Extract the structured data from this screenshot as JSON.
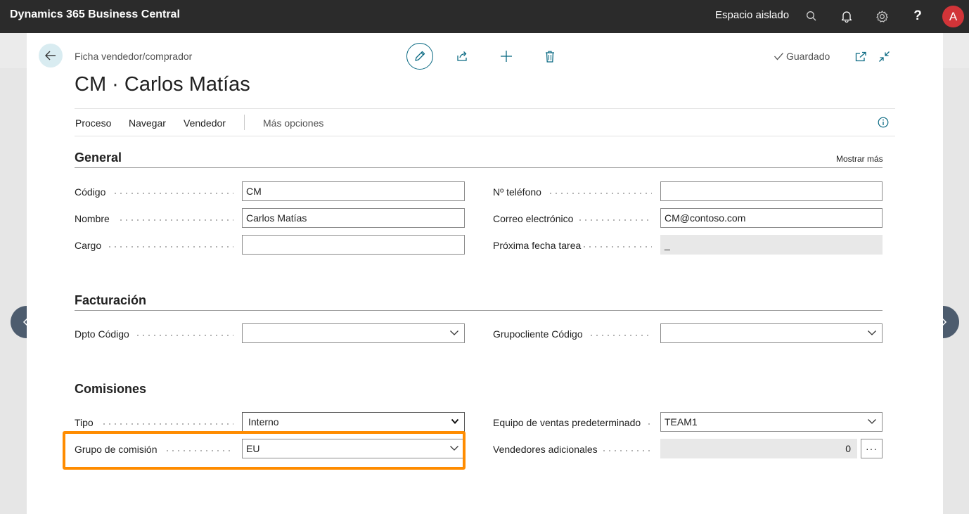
{
  "topbar": {
    "app_title": "Dynamics 365 Business Central",
    "environment": "Espacio aislado",
    "help": "?",
    "avatar_initial": "A",
    "avatar_color": "#d13438"
  },
  "page": {
    "breadcrumb": "Ficha vendedor/comprador",
    "title": "CM · Carlos Matías",
    "saved_status": "Guardado"
  },
  "actionbar": {
    "items": [
      "Proceso",
      "Navegar",
      "Vendedor"
    ],
    "more": "Más opciones"
  },
  "sections": {
    "general": {
      "title": "General",
      "show_more": "Mostrar más",
      "fields": {
        "codigo": {
          "label": "Código",
          "value": "CM"
        },
        "nombre": {
          "label": "Nombre",
          "value": "Carlos Matías"
        },
        "cargo": {
          "label": "Cargo",
          "value": ""
        },
        "telefono": {
          "label": "Nº teléfono",
          "value": ""
        },
        "correo": {
          "label": "Correo electrónico",
          "value": "CM@contoso.com"
        },
        "proxima_fecha": {
          "label": "Próxima fecha tarea",
          "value": "_"
        }
      }
    },
    "facturacion": {
      "title": "Facturación",
      "fields": {
        "dpto": {
          "label": "Dpto Código",
          "value": ""
        },
        "grupocliente": {
          "label": "Grupocliente Código",
          "value": ""
        }
      }
    },
    "comisiones": {
      "title": "Comisiones",
      "fields": {
        "tipo": {
          "label": "Tipo",
          "value": "Interno"
        },
        "grupo_comision": {
          "label": "Grupo de comisión",
          "value": "EU"
        },
        "equipo": {
          "label": "Equipo de ventas predeterminado",
          "value": "TEAM1"
        },
        "vendedores_adicionales": {
          "label": "Vendedores adicionales",
          "value": "0",
          "button": "···"
        }
      }
    }
  },
  "icons": {
    "back": "back-arrow-icon",
    "edit": "pencil-icon",
    "share": "share-icon",
    "add": "plus-icon",
    "delete": "trash-icon",
    "saved": "checkmark-icon",
    "open_new": "open-in-new-window-icon",
    "collapse": "collapse-icon",
    "info": "info-icon",
    "prev": "chevron-left-icon",
    "next": "chevron-right-icon"
  },
  "colors": {
    "accent": "#0b6a83",
    "highlight": "#ff8c00",
    "topbar": "#2b2b2b"
  }
}
